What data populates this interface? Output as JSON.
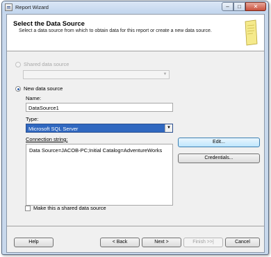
{
  "window": {
    "title": "Report Wizard",
    "controls": {
      "minimize": "–",
      "maximize": "□",
      "close": "✕"
    }
  },
  "header": {
    "title": "Select the Data Source",
    "subtitle": "Select a data source from which to obtain data for this report or create a new data source."
  },
  "shared_source": {
    "label": "Shared data source",
    "value": ""
  },
  "new_source": {
    "label": "New data source",
    "name_label": "Name:",
    "name_value": "DataSource1",
    "type_label": "Type:",
    "type_value": "Microsoft SQL Server",
    "conn_label": "Connection string:",
    "conn_value": "Data Source=JACOB-PC;Initial Catalog=AdventureWorks",
    "edit_label": "Edit...",
    "credentials_label": "Credentials...",
    "make_shared_label": "Make this a shared data source"
  },
  "footer": {
    "help": "Help",
    "back": "< Back",
    "next": "Next >",
    "finish": "Finish >>|",
    "cancel": "Cancel"
  },
  "icons": {
    "combo_arrow": "▼"
  }
}
